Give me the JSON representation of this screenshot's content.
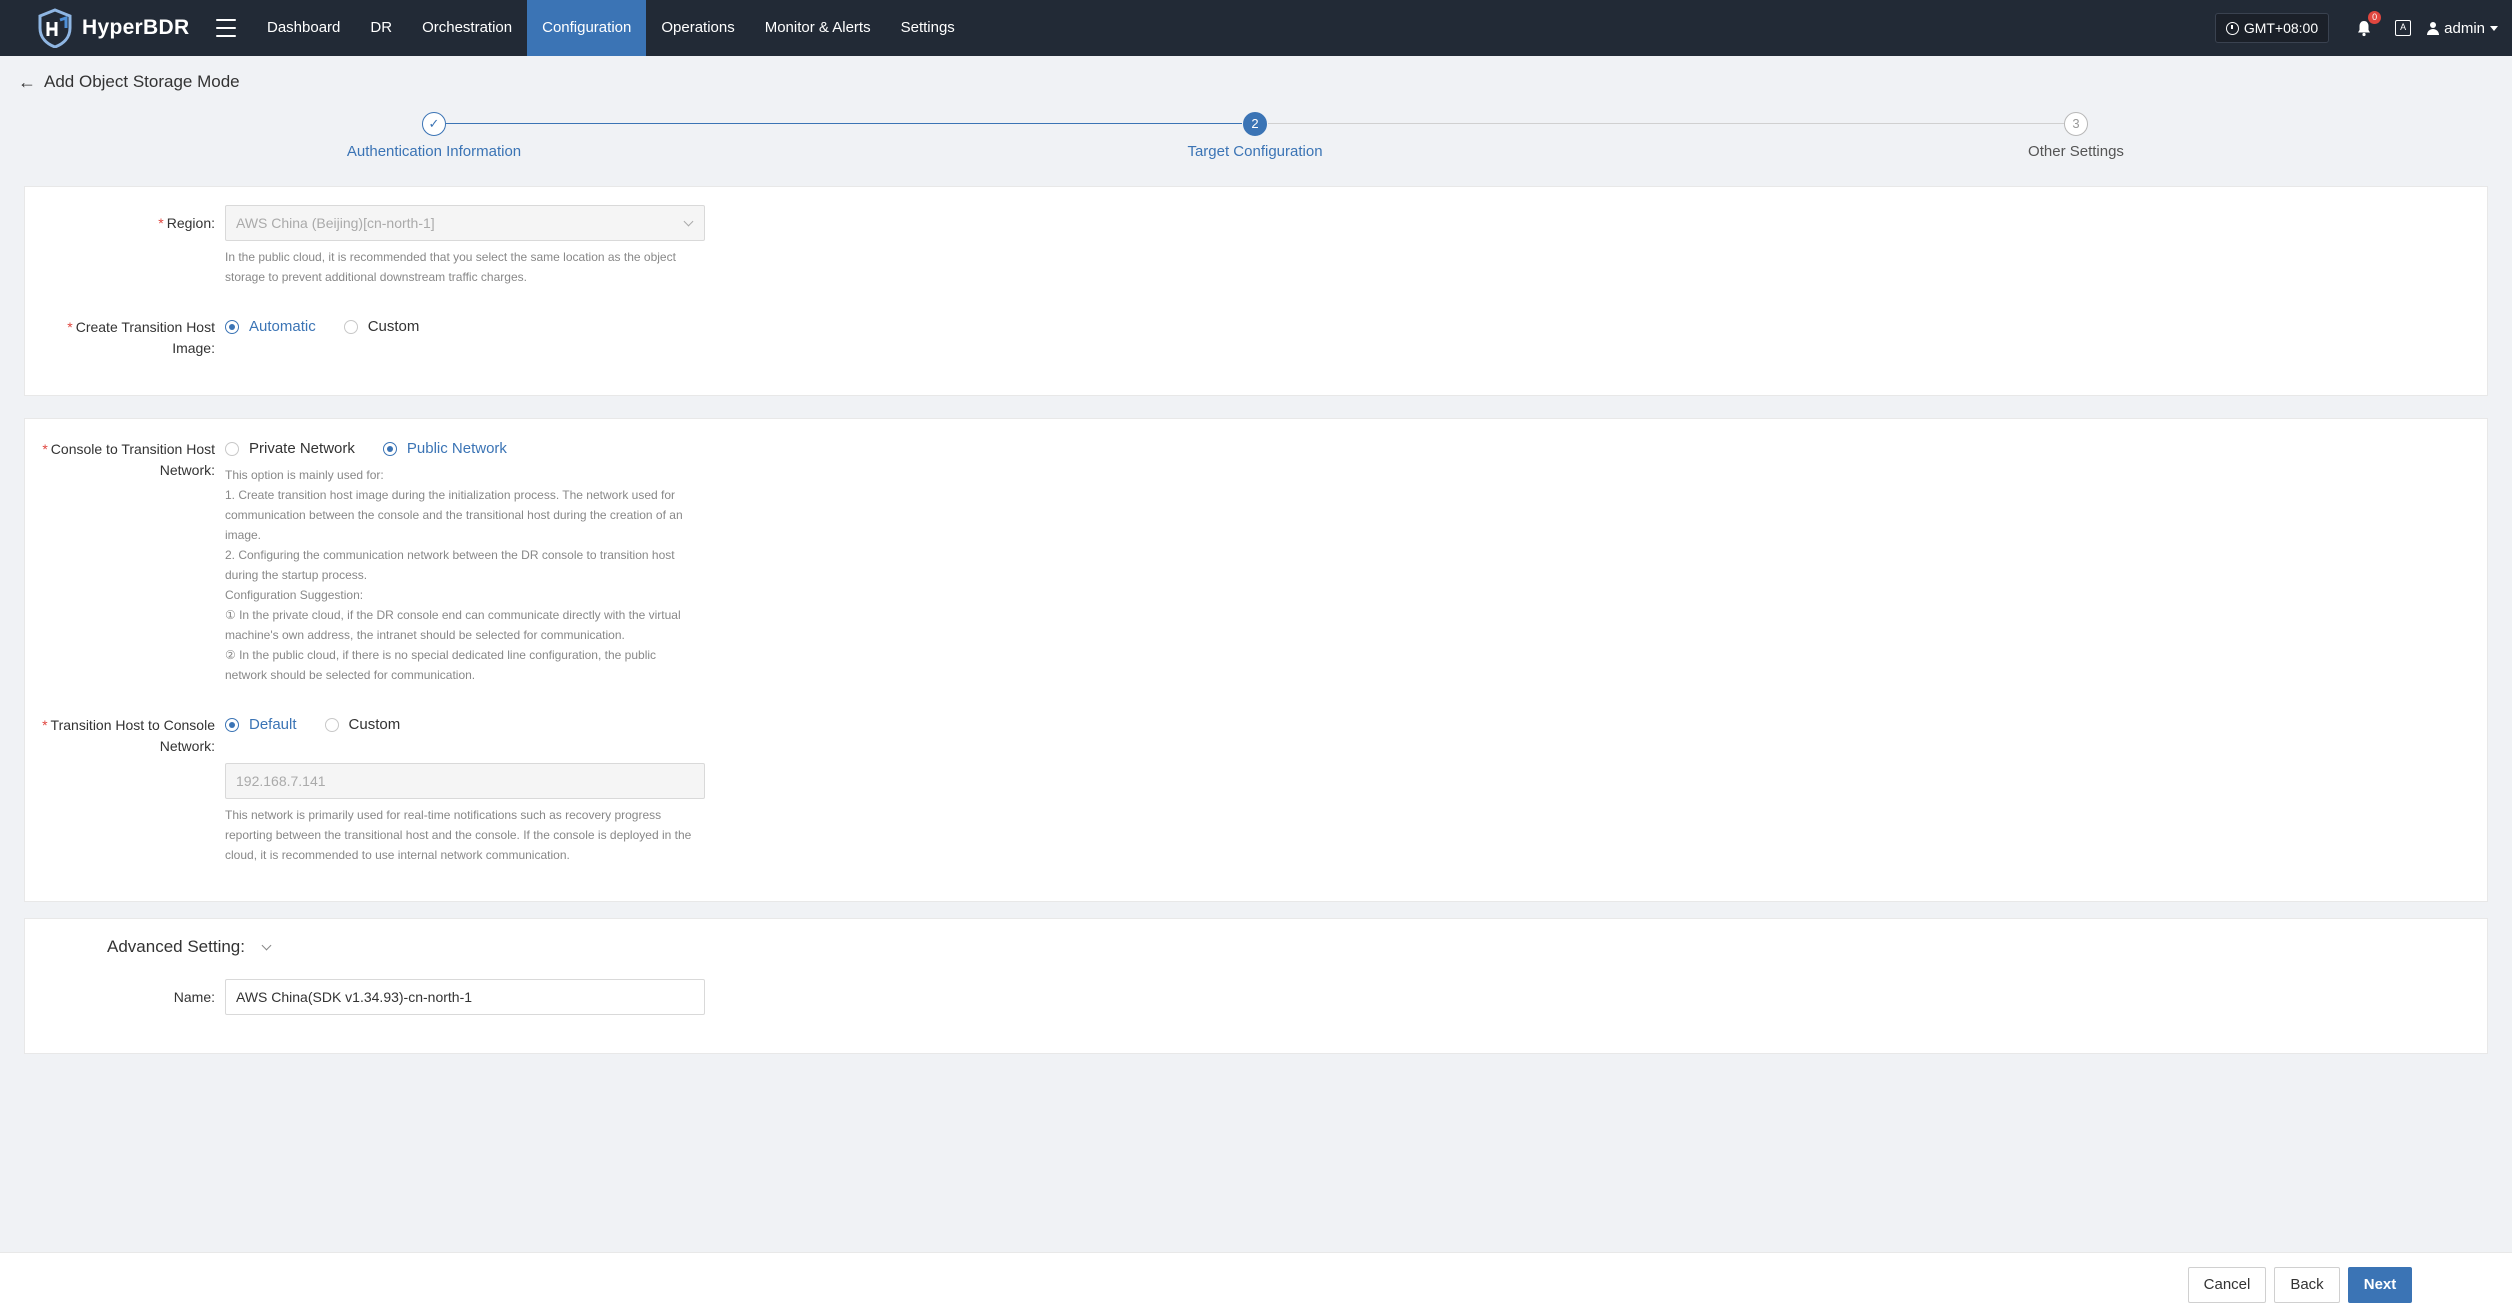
{
  "app": {
    "name": "HyperBDR"
  },
  "nav": {
    "items": [
      {
        "label": "Dashboard"
      },
      {
        "label": "DR"
      },
      {
        "label": "Orchestration"
      },
      {
        "label": "Configuration",
        "active": true
      },
      {
        "label": "Operations"
      },
      {
        "label": "Monitor & Alerts"
      },
      {
        "label": "Settings"
      }
    ]
  },
  "topbar": {
    "timezone": "GMT+08:00",
    "notification_count": "0",
    "lang_icon": "A",
    "user": "admin"
  },
  "page": {
    "title": "Add Object Storage Mode"
  },
  "steps": [
    {
      "label": "Authentication Information",
      "state": "done",
      "number": ""
    },
    {
      "label": "Target Configuration",
      "state": "current",
      "number": "2"
    },
    {
      "label": "Other Settings",
      "state": "pending",
      "number": "3"
    }
  ],
  "form": {
    "region": {
      "label": "Region:",
      "value": "AWS China (Beijing)[cn-north-1]",
      "help_line1": "In the public cloud, it is recommended that you select the same location as the object",
      "help_line2": "storage to prevent additional downstream traffic charges."
    },
    "transition_image": {
      "label_line1": "Create Transition Host",
      "label_line2": "Image:",
      "options": [
        "Automatic",
        "Custom"
      ],
      "selected": "Automatic"
    },
    "console_network": {
      "label_line1": "Console to Transition Host",
      "label_line2": "Network:",
      "options": [
        "Private Network",
        "Public Network"
      ],
      "selected": "Public Network",
      "help": [
        "This option is mainly used for:",
        "1. Create transition host image during the initialization process. The network used for",
        "communication between the console and the transitional host during the creation of an",
        "image.",
        "2. Configuring the communication network between the DR console to transition host",
        "during the startup process.",
        "Configuration Suggestion:",
        "① In the private cloud, if the DR console end can communicate directly with the virtual",
        "machine's own address, the intranet should be selected for communication.",
        "② In the public cloud, if there is no special dedicated line configuration, the public",
        "network should be selected for communication."
      ]
    },
    "host_to_console": {
      "label_line1": "Transition Host to Console",
      "label_line2": "Network:",
      "options": [
        "Default",
        "Custom"
      ],
      "selected": "Default",
      "ip": "192.168.7.141",
      "help": [
        "This network is primarily used for real-time notifications such as recovery progress",
        "reporting between the transitional host and the console. If the console is deployed in the",
        "cloud, it is recommended to use internal network communication."
      ]
    },
    "advanced": {
      "title": "Advanced Setting:",
      "name_label": "Name:",
      "name_value": "AWS China(SDK v1.34.93)-cn-north-1"
    }
  },
  "footer": {
    "cancel": "Cancel",
    "back": "Back",
    "next": "Next"
  },
  "colors": {
    "topbar": "#222a36",
    "accent": "#3b74b5",
    "required": "#e0463f"
  }
}
